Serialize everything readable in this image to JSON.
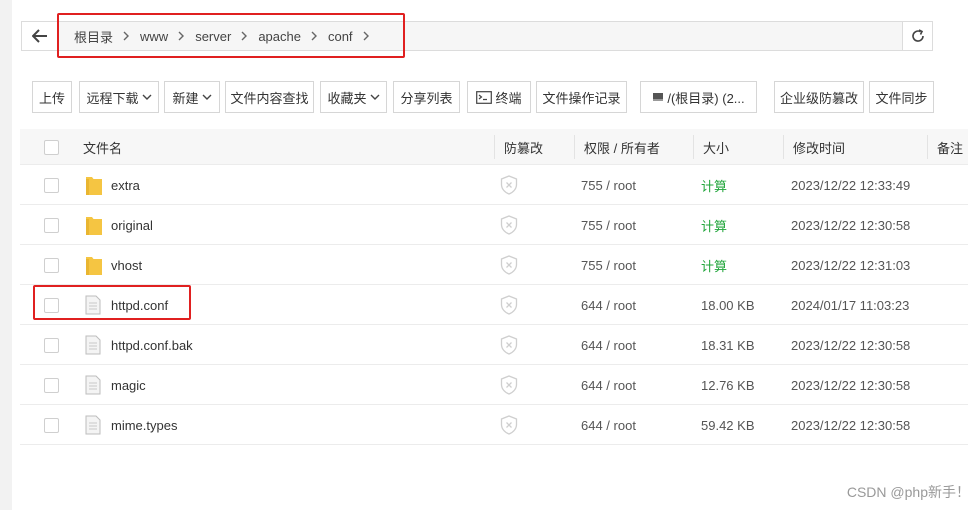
{
  "breadcrumb": {
    "items": [
      "根目录",
      "www",
      "server",
      "apache",
      "conf"
    ]
  },
  "toolbar": {
    "upload": "上传",
    "remote_download": "远程下载",
    "new": "新建",
    "content_search": "文件内容查找",
    "favorites": "收藏夹",
    "share_list": "分享列表",
    "terminal": "终端",
    "operation_log": "文件操作记录",
    "disk": "/(根目录) (2...",
    "tamper_protect": "企业级防篡改",
    "file_sync": "文件同步"
  },
  "table": {
    "headers": {
      "name": "文件名",
      "tamper": "防篡改",
      "permission": "权限 / 所有者",
      "size": "大小",
      "modified": "修改时间",
      "note": "备注"
    },
    "rows": [
      {
        "type": "folder",
        "name": "extra",
        "permission": "755 / root",
        "size": "计算",
        "modified": "2023/12/22 12:33:49"
      },
      {
        "type": "folder",
        "name": "original",
        "permission": "755 / root",
        "size": "计算",
        "modified": "2023/12/22 12:30:58"
      },
      {
        "type": "folder",
        "name": "vhost",
        "permission": "755 / root",
        "size": "计算",
        "modified": "2023/12/22 12:31:03"
      },
      {
        "type": "file",
        "name": "httpd.conf",
        "permission": "644 / root",
        "size": "18.00 KB",
        "modified": "2024/01/17 11:03:23"
      },
      {
        "type": "file",
        "name": "httpd.conf.bak",
        "permission": "644 / root",
        "size": "18.31 KB",
        "modified": "2023/12/22 12:30:58"
      },
      {
        "type": "file",
        "name": "magic",
        "permission": "644 / root",
        "size": "12.76 KB",
        "modified": "2023/12/22 12:30:58"
      },
      {
        "type": "file",
        "name": "mime.types",
        "permission": "644 / root",
        "size": "59.42 KB",
        "modified": "2023/12/22 12:30:58"
      }
    ]
  },
  "watermark": "CSDN @php新手！",
  "colors": {
    "accent_green": "#20a53a",
    "highlight_red": "#e02020",
    "folder_yellow": "#f5c542"
  },
  "icons": {
    "back": "arrow-left-icon",
    "refresh": "refresh-icon",
    "breadcrumb_sep": "chevron-right-icon",
    "dropdown": "chevron-down-icon",
    "terminal": "terminal-icon",
    "disk": "disk-icon",
    "folder": "folder-icon",
    "file": "file-icon",
    "tamper": "shield-x-icon"
  }
}
